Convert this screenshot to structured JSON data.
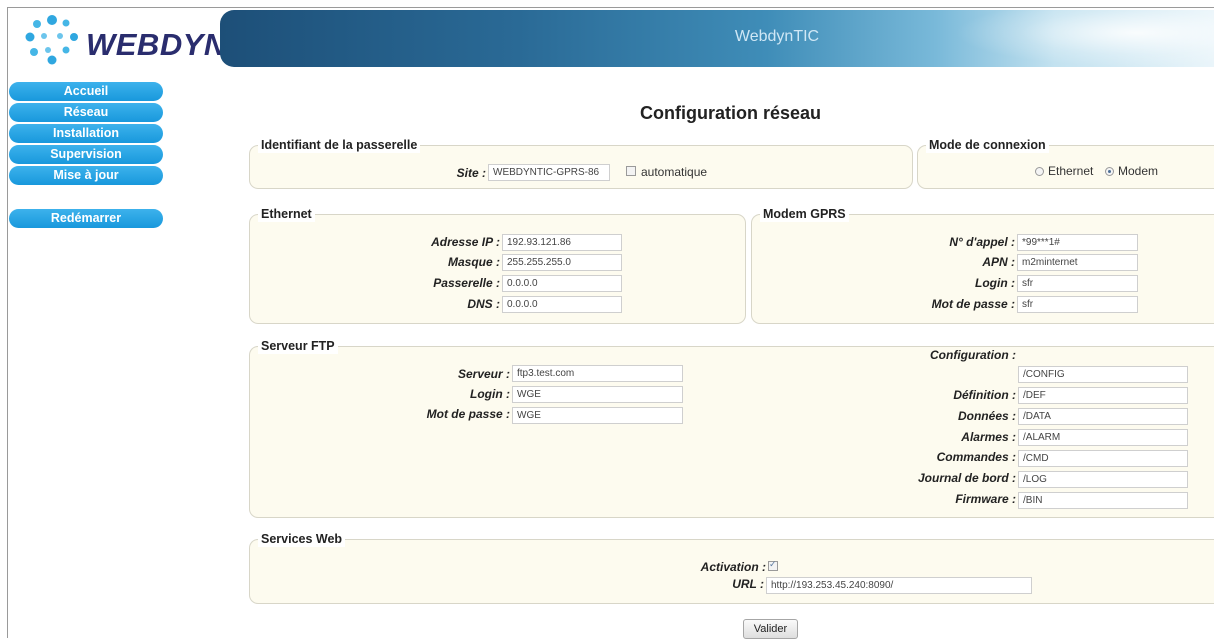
{
  "app": {
    "logo_text": "WEBDYN",
    "banner_title": "WebdynTIC"
  },
  "nav": {
    "items": [
      {
        "label": "Accueil"
      },
      {
        "label": "Réseau"
      },
      {
        "label": "Installation"
      },
      {
        "label": "Supervision"
      },
      {
        "label": "Mise à jour"
      }
    ],
    "restart_label": "Redémarrer"
  },
  "page": {
    "title": "Configuration réseau"
  },
  "gateway": {
    "legend": "Identifiant de la passerelle",
    "site_label": "Site :",
    "site_value": "WEBDYNTIC-GPRS-86",
    "auto_label": "automatique",
    "auto_checked": false
  },
  "connection": {
    "legend": "Mode de connexion",
    "ethernet_label": "Ethernet",
    "modem_label": "Modem",
    "selected": "Modem"
  },
  "ethernet": {
    "legend": "Ethernet",
    "ip_label": "Adresse IP :",
    "ip_value": "192.93.121.86",
    "mask_label": "Masque :",
    "mask_value": "255.255.255.0",
    "gateway_label": "Passerelle :",
    "gateway_value": "0.0.0.0",
    "dns_label": "DNS :",
    "dns_value": "0.0.0.0"
  },
  "modem": {
    "legend": "Modem GPRS",
    "call_label": "N° d'appel :",
    "call_value": "*99***1#",
    "apn_label": "APN :",
    "apn_value": "m2minternet",
    "login_label": "Login :",
    "login_value": "sfr",
    "password_label": "Mot de passe :",
    "password_value": "sfr"
  },
  "ftp": {
    "legend": "Serveur FTP",
    "server_label": "Serveur :",
    "server_value": "ftp3.test.com",
    "login_label": "Login :",
    "login_value": "WGE",
    "password_label": "Mot de passe :",
    "password_value": "WGE",
    "config_label": "Configuration :",
    "config_value": "/CONFIG",
    "definition_label": "Définition :",
    "definition_value": "/DEF",
    "data_label": "Données :",
    "data_value": "/DATA",
    "alarms_label": "Alarmes :",
    "alarms_value": "/ALARM",
    "commands_label": "Commandes :",
    "commands_value": "/CMD",
    "log_label": "Journal de bord :",
    "log_value": "/LOG",
    "firmware_label": "Firmware :",
    "firmware_value": "/BIN"
  },
  "web": {
    "legend": "Services Web",
    "activation_label": "Activation :",
    "activation_checked": true,
    "url_label": "URL :",
    "url_value": "http://193.253.45.240:8090/"
  },
  "actions": {
    "submit_label": "Valider"
  },
  "colors": {
    "nav": "#1898dc",
    "logo_text": "#2a2d6e",
    "logo_dots": "#2fa7e0",
    "fieldset_bg": "#fdfbef"
  }
}
